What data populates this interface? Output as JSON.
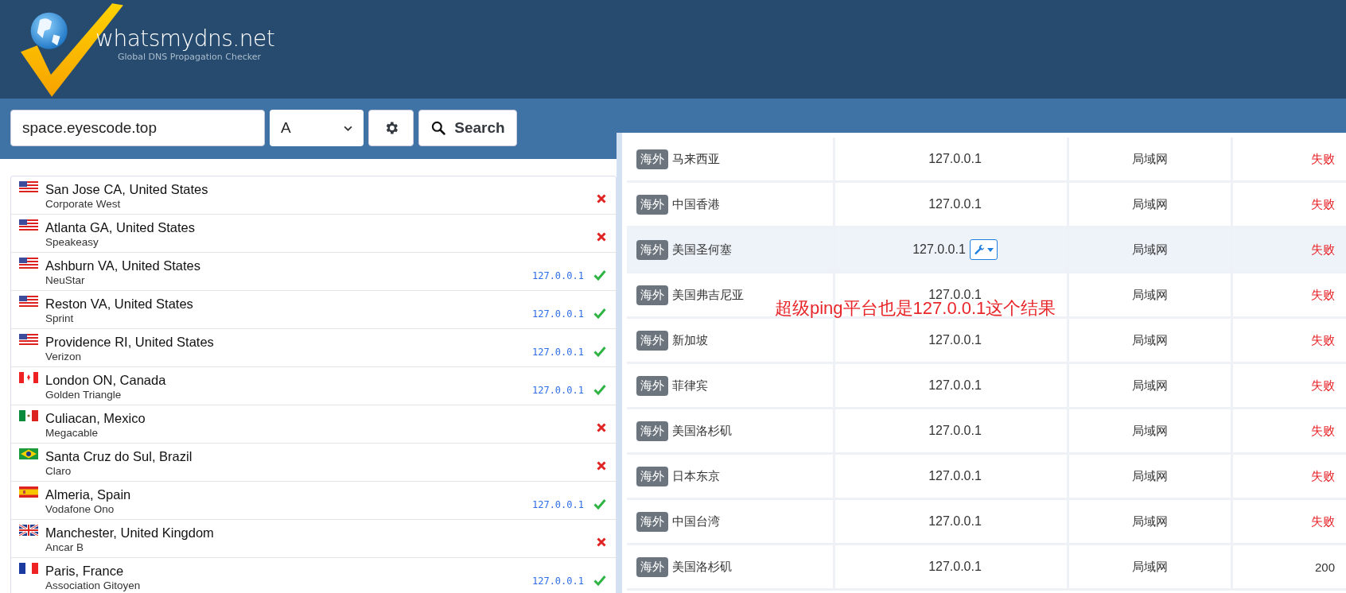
{
  "header": {
    "site_name": "whatsmydns.net",
    "tagline": "Global DNS Propagation Checker"
  },
  "search": {
    "value": "space.eyescode.top",
    "record_type": "A",
    "button": "Search"
  },
  "results": [
    {
      "kind": "us",
      "location": "San Jose CA, United States",
      "provider": "Corporate West",
      "ok": false
    },
    {
      "kind": "us",
      "location": "Atlanta GA, United States",
      "provider": "Speakeasy",
      "ok": false
    },
    {
      "kind": "us",
      "location": "Ashburn VA, United States",
      "provider": "NeuStar",
      "ip": "127.0.0.1",
      "ok": true
    },
    {
      "kind": "us",
      "location": "Reston VA, United States",
      "provider": "Sprint",
      "ip": "127.0.0.1",
      "ok": true
    },
    {
      "kind": "us",
      "location": "Providence RI, United States",
      "provider": "Verizon",
      "ip": "127.0.0.1",
      "ok": true
    },
    {
      "kind": "ca",
      "location": "London ON, Canada",
      "provider": "Golden Triangle",
      "ip": "127.0.0.1",
      "ok": true
    },
    {
      "kind": "mx",
      "location": "Culiacan, Mexico",
      "provider": "Megacable",
      "ok": false
    },
    {
      "kind": "br",
      "location": "Santa Cruz do Sul, Brazil",
      "provider": "Claro",
      "ok": false
    },
    {
      "kind": "es",
      "location": "Almeria, Spain",
      "provider": "Vodafone Ono",
      "ip": "127.0.0.1",
      "ok": true
    },
    {
      "kind": "gb",
      "location": "Manchester, United Kingdom",
      "provider": "Ancar B",
      "ok": false
    },
    {
      "kind": "fr",
      "location": "Paris, France",
      "provider": "Association Gitoyen",
      "ip": "127.0.0.1",
      "ok": true
    }
  ],
  "ping_panel": {
    "rows": [
      {
        "badge": "海外",
        "location": "马来西亚",
        "ip": "127.0.0.1",
        "network": "局域网",
        "status": "失败",
        "kind": "fail",
        "tool": false,
        "selected": false
      },
      {
        "badge": "海外",
        "location": "中国香港",
        "ip": "127.0.0.1",
        "network": "局域网",
        "status": "失败",
        "kind": "fail",
        "tool": false,
        "selected": false
      },
      {
        "badge": "海外",
        "location": "美国圣何塞",
        "ip": "127.0.0.1",
        "network": "局域网",
        "status": "失败",
        "kind": "fail",
        "tool": true,
        "selected": true
      },
      {
        "badge": "海外",
        "location": "美国弗吉尼亚",
        "ip": "127.0.0.1",
        "network": "局域网",
        "status": "失败",
        "kind": "fail",
        "tool": false,
        "selected": false
      },
      {
        "badge": "海外",
        "location": "新加坡",
        "ip": "127.0.0.1",
        "network": "局域网",
        "status": "失败",
        "kind": "fail",
        "tool": false,
        "selected": false
      },
      {
        "badge": "海外",
        "location": "菲律宾",
        "ip": "127.0.0.1",
        "network": "局域网",
        "status": "失败",
        "kind": "fail",
        "tool": false,
        "selected": false
      },
      {
        "badge": "海外",
        "location": "美国洛杉矶",
        "ip": "127.0.0.1",
        "network": "局域网",
        "status": "失败",
        "kind": "fail",
        "tool": false,
        "selected": false
      },
      {
        "badge": "海外",
        "location": "日本东京",
        "ip": "127.0.0.1",
        "network": "局域网",
        "status": "失败",
        "kind": "fail",
        "tool": false,
        "selected": false
      },
      {
        "badge": "海外",
        "location": "中国台湾",
        "ip": "127.0.0.1",
        "network": "局域网",
        "status": "失败",
        "kind": "fail",
        "tool": false,
        "selected": false
      },
      {
        "badge": "海外",
        "location": "美国洛杉矶",
        "ip": "127.0.0.1",
        "network": "局域网",
        "status": "200",
        "kind": "ok",
        "tool": false,
        "selected": false
      }
    ],
    "annotation": "超级ping平台也是127.0.0.1这个结果"
  }
}
